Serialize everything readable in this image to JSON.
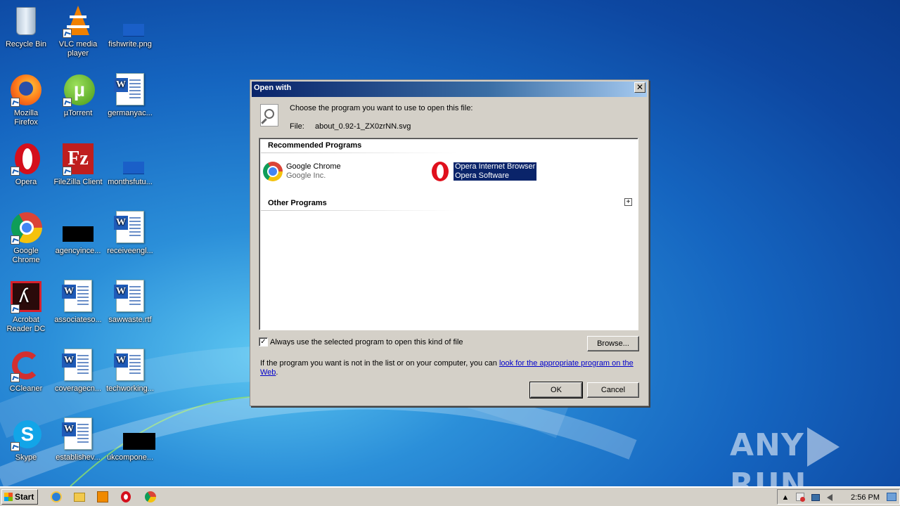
{
  "desktop": {
    "icons": [
      {
        "label": "Recycle Bin"
      },
      {
        "label": "VLC media player"
      },
      {
        "label": "fishwrite.png"
      },
      {
        "label": "Mozilla Firefox"
      },
      {
        "label": "µTorrent"
      },
      {
        "label": "germanyac..."
      },
      {
        "label": "Opera"
      },
      {
        "label": "FileZilla Client"
      },
      {
        "label": "monthsfutu..."
      },
      {
        "label": "Google Chrome"
      },
      {
        "label": "agencyince..."
      },
      {
        "label": "receiveengl..."
      },
      {
        "label": "Acrobat Reader DC"
      },
      {
        "label": "associateso..."
      },
      {
        "label": "sawwaste.rtf"
      },
      {
        "label": "CCleaner"
      },
      {
        "label": "coveragecn..."
      },
      {
        "label": "techworking..."
      },
      {
        "label": "Skype"
      },
      {
        "label": "establishev..."
      },
      {
        "label": "ukcompone..."
      }
    ]
  },
  "dialog": {
    "title": "Open with",
    "close": "✕",
    "instruction": "Choose the program you want to use to open this file:",
    "file_label": "File:",
    "file_name": "about_0.92-1_ZX0zrNN.svg",
    "recommended_header": "Recommended Programs",
    "other_header": "Other Programs",
    "expand": "+",
    "programs": [
      {
        "name": "Google Chrome",
        "publisher": "Google Inc.",
        "icon": "chrome-icon"
      },
      {
        "name": "Opera Internet Browser",
        "publisher": "Opera Software",
        "icon": "opera-icon",
        "selected": true
      }
    ],
    "always_use": {
      "label": "Always use the selected program to open this kind of file",
      "checked": true,
      "mark": "✓"
    },
    "browse_label": "Browse...",
    "hint_text": "If the program you want is not in the list or on your computer, you can ",
    "hint_link": "look for the appropriate program on the Web",
    "hint_end": ".",
    "ok_label": "OK",
    "cancel_label": "Cancel"
  },
  "taskbar": {
    "start_label": "Start",
    "clock": "2:56 PM",
    "tray_arrow": "▲"
  },
  "watermark": {
    "left": "ANY",
    "right": "RUN"
  }
}
